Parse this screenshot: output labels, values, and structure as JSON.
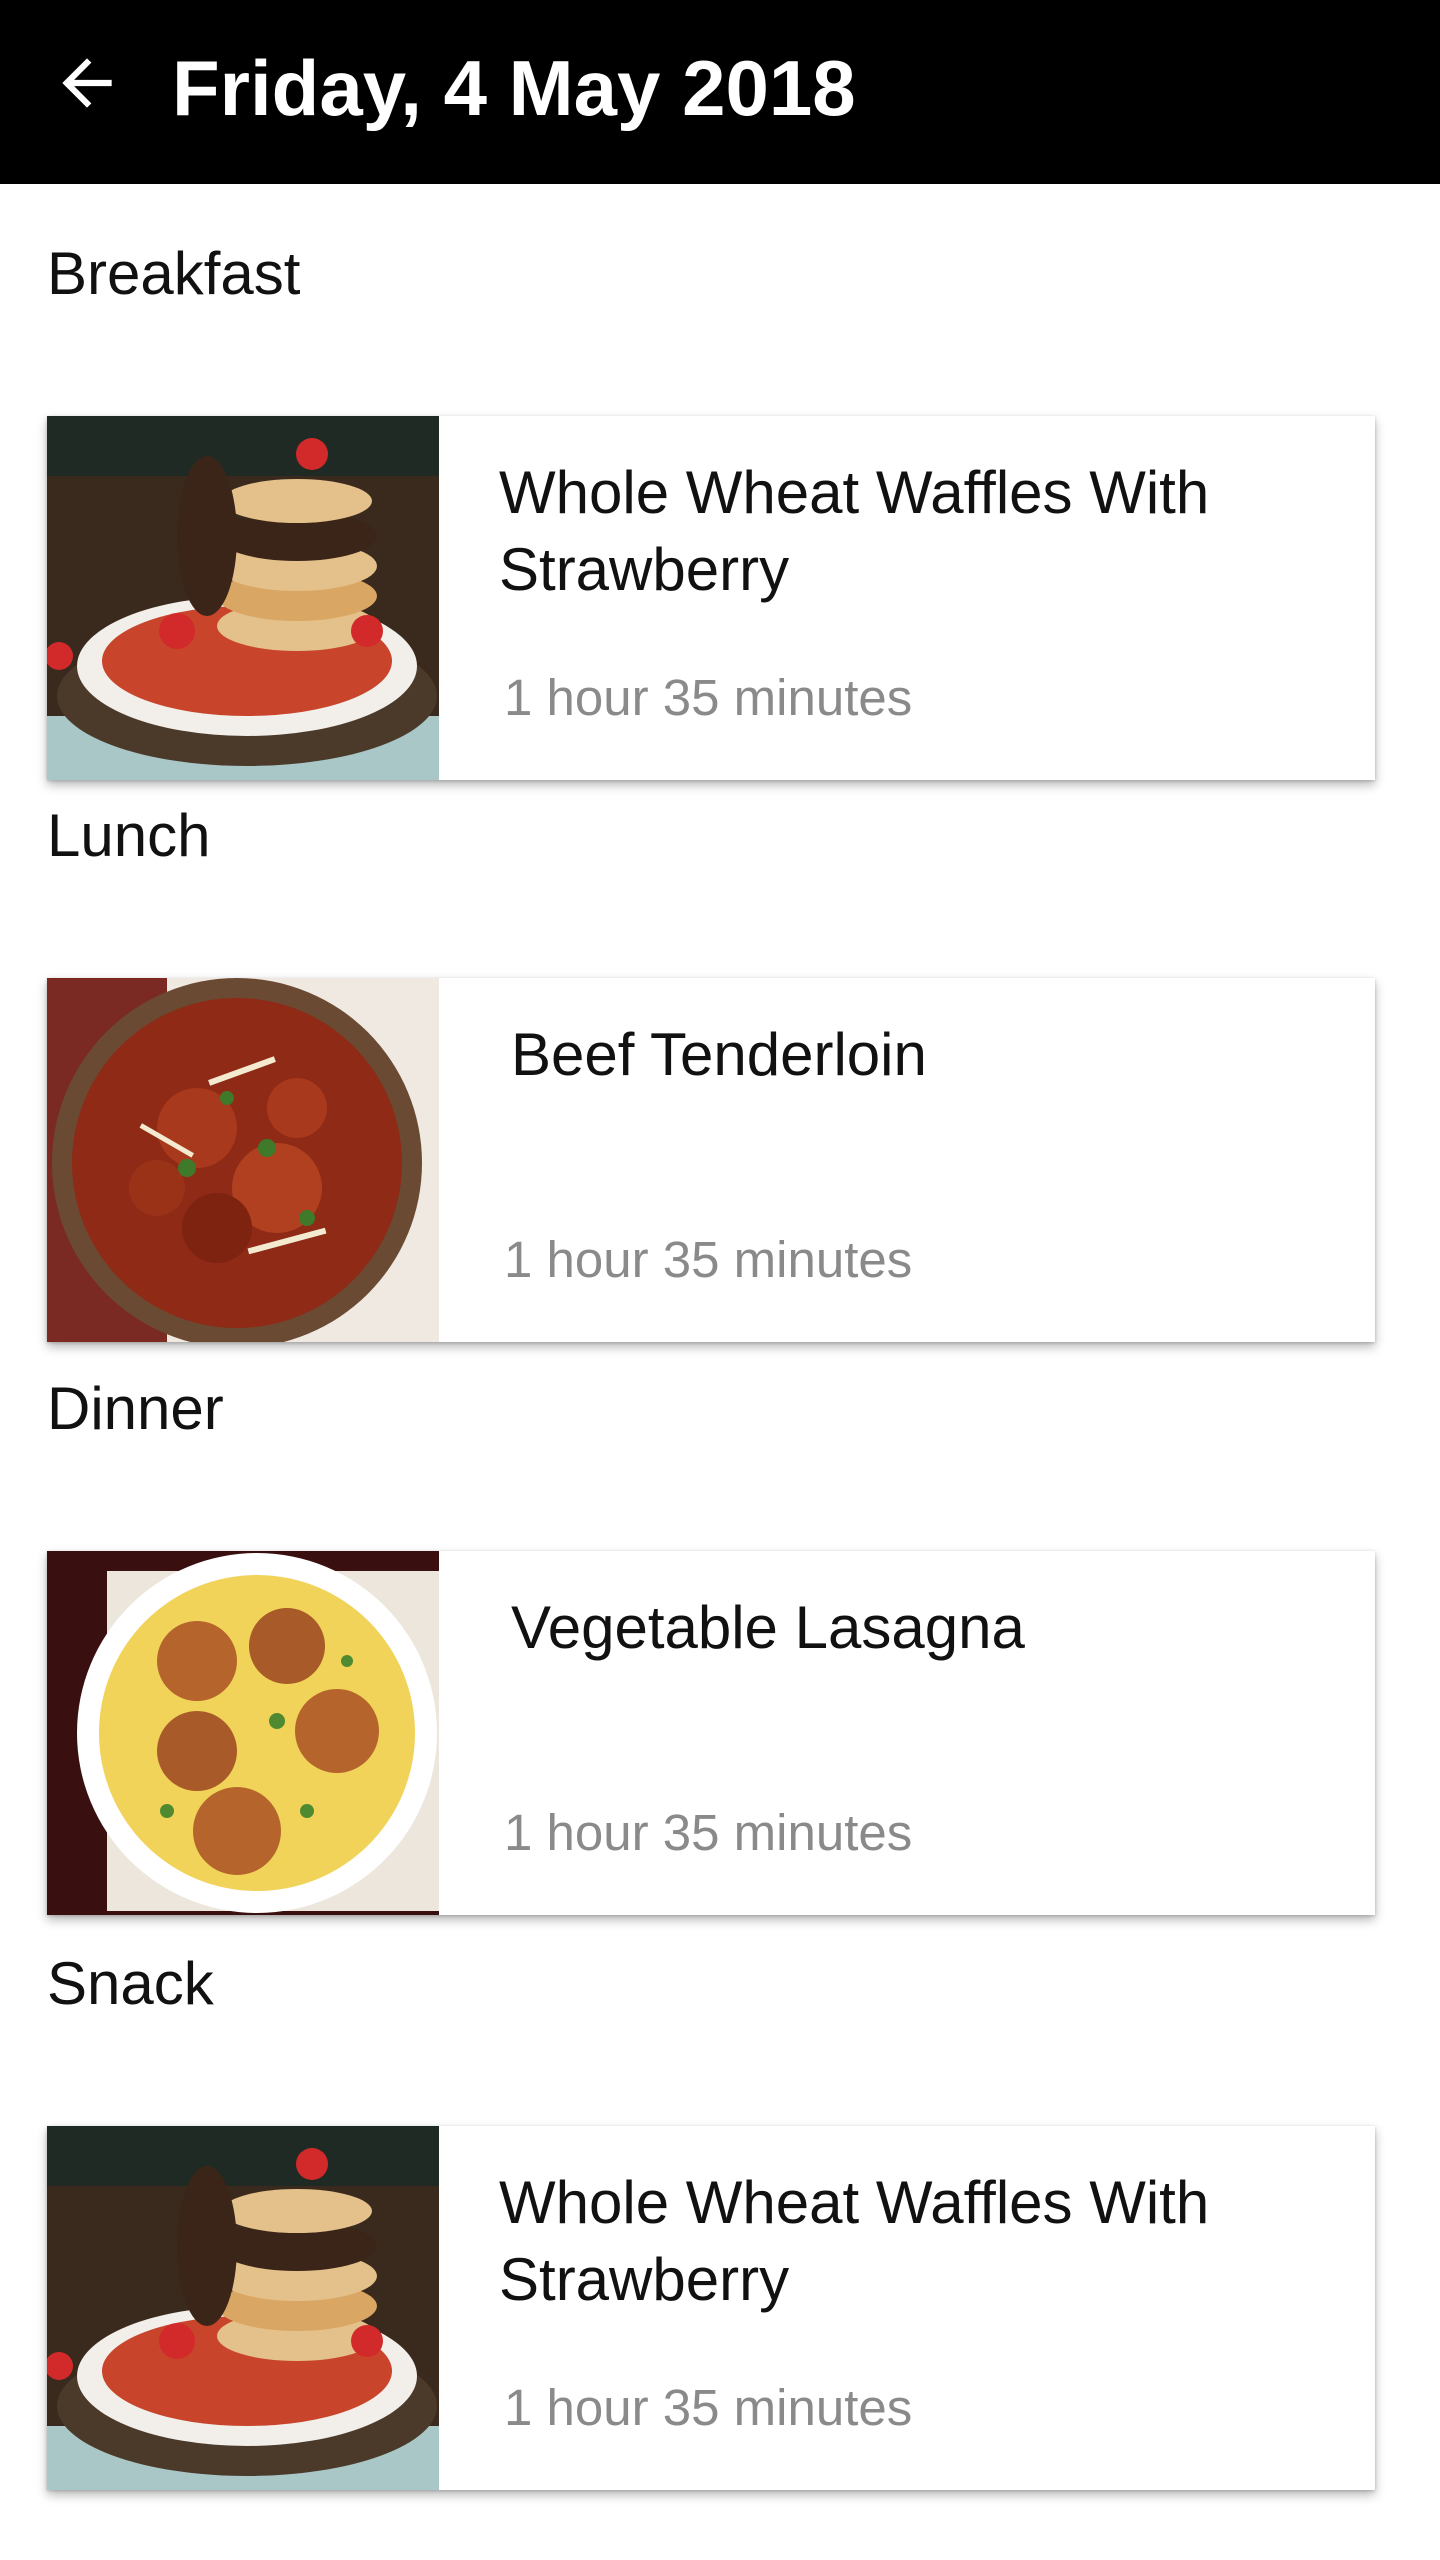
{
  "header": {
    "title": "Friday, 4 May 2018",
    "back_icon": "arrow-left-icon"
  },
  "meals": [
    {
      "section": "Breakfast",
      "recipe": "Whole Wheat Waffles With Strawberry",
      "duration": "1 hour 35 minutes",
      "image": "waffles-photo"
    },
    {
      "section": "Lunch",
      "recipe": "Beef Tenderloin",
      "duration": "1 hour 35 minutes",
      "image": "beef-curry-photo"
    },
    {
      "section": "Dinner",
      "recipe": "Vegetable Lasagna",
      "duration": "1 hour 35 minutes",
      "image": "kadhi-pakora-photo"
    },
    {
      "section": "Snack",
      "recipe": "Whole Wheat Waffles With Strawberry",
      "duration": "1 hour 35 minutes",
      "image": "waffles-photo"
    }
  ],
  "colors": {
    "app_bar": "#000000",
    "title_text": "#ffffff",
    "duration_text": "#8a8a8a",
    "background": "#ffffff"
  }
}
